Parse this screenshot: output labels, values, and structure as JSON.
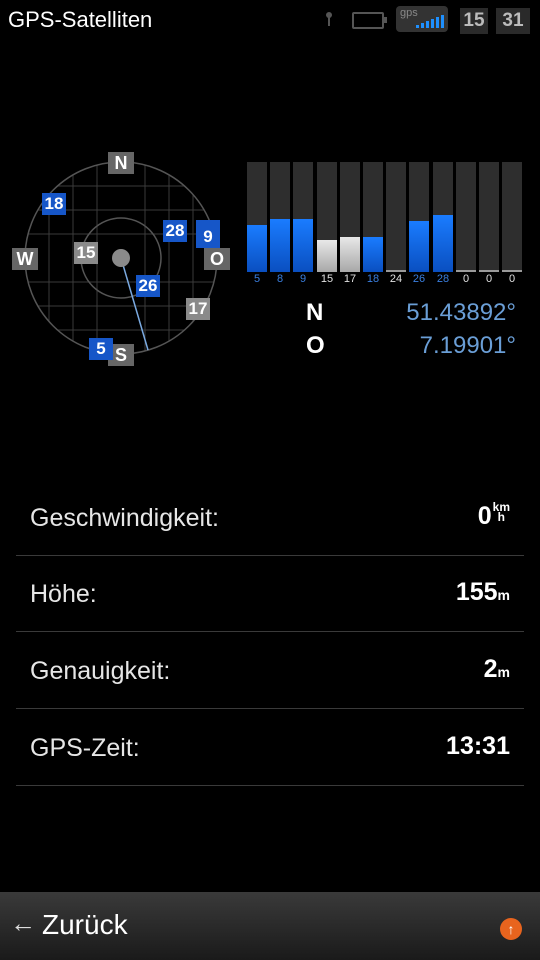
{
  "status_bar": {
    "app_title": "GPS-Satelliten",
    "gps_badge": "gps",
    "clock_hour": "15",
    "clock_minute": "31"
  },
  "skyplot": {
    "compass": {
      "north": "N",
      "south": "S",
      "west": "W",
      "east": "O"
    },
    "satellites": [
      {
        "id": "18",
        "used": true
      },
      {
        "id": "15",
        "used": false
      },
      {
        "id": "28",
        "used": true
      },
      {
        "id": "9",
        "used": true
      },
      {
        "id": "26",
        "used": true
      },
      {
        "id": "17",
        "used": false
      },
      {
        "id": "5",
        "used": true
      }
    ]
  },
  "signal_bars": [
    {
      "label": "5",
      "level": 0.43,
      "used": true
    },
    {
      "label": "8",
      "level": 0.48,
      "used": true
    },
    {
      "label": "9",
      "level": 0.48,
      "used": true
    },
    {
      "label": "15",
      "level": 0.29,
      "used": false
    },
    {
      "label": "17",
      "level": 0.32,
      "used": false
    },
    {
      "label": "18",
      "level": 0.32,
      "used": true
    },
    {
      "label": "24",
      "level": 0.0,
      "used": false
    },
    {
      "label": "26",
      "level": 0.46,
      "used": true
    },
    {
      "label": "28",
      "level": 0.52,
      "used": true
    },
    {
      "label": "0",
      "level": 0.0,
      "used": false
    },
    {
      "label": "0",
      "level": 0.0,
      "used": false
    },
    {
      "label": "0",
      "level": 0.0,
      "used": false
    }
  ],
  "colors": {
    "used_signal": "#1a7cff",
    "unused_signal": "#cfcfcf",
    "used_label": "#3a7fe0",
    "unused_label": "#e0e0e0"
  },
  "coordinates": {
    "lat_letter": "N",
    "lat_value": "51.43892°",
    "lon_letter": "O",
    "lon_value": "7.19901°"
  },
  "info": {
    "speed_label": "Geschwindigkeit:",
    "speed_value": "0",
    "speed_unit_top": "km",
    "speed_unit_bottom": "h",
    "height_label": "Höhe:",
    "height_value": "155",
    "height_unit": "m",
    "accuracy_label": "Genauigkeit:",
    "accuracy_value": "2",
    "accuracy_unit": "m",
    "time_label": "GPS-Zeit:",
    "time_value": "13:31"
  },
  "bottom_bar": {
    "back_label": "Zurück"
  }
}
